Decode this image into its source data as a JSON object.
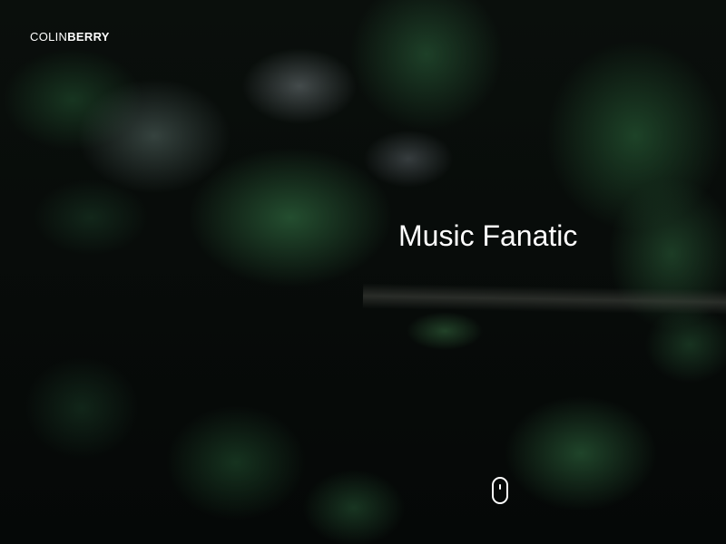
{
  "brand": {
    "first": "COLIN",
    "second": "BERRY"
  },
  "hero": {
    "tagline": "Music Fanatic",
    "scroll_indicator_icon": "mouse-scroll-icon"
  },
  "colors": {
    "text": "#ffffff",
    "background": "#050807",
    "foliage": "#2d6440"
  }
}
